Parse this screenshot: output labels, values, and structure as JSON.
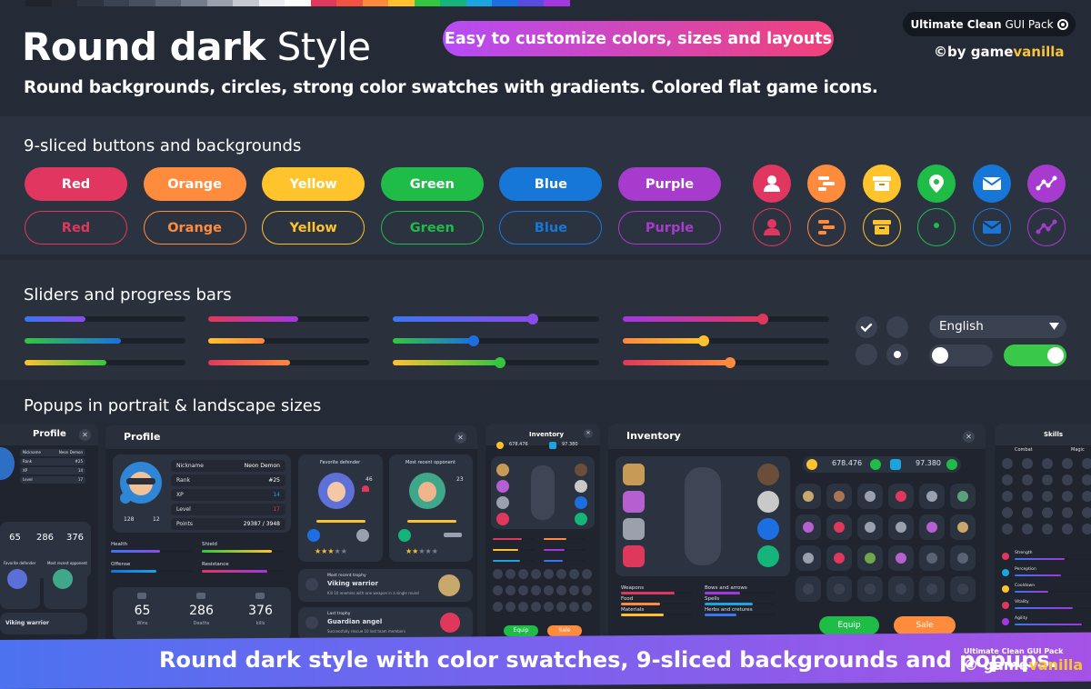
{
  "header": {
    "title_bold": "Round dark",
    "title_light": "Style",
    "subtitle": "Round backgrounds, circles, strong color swatches with gradients. Colored flat game icons.",
    "pill": "Easy to customize colors, sizes and layouts",
    "pack_bold": "Ultimate Clean",
    "pack_rest": "GUI Pack",
    "byline_pre": "©by game",
    "byline_accent": "vanilla"
  },
  "swatches": [
    "#1f232b",
    "#262b35",
    "#2e3440",
    "#3a4150",
    "#47505f",
    "#5a6373",
    "#747d8c",
    "#9aa1ad",
    "#c4c9d1",
    "#eceef1",
    "#ffffff",
    "#e0385c",
    "#f25240",
    "#ff8a3d",
    "#ffc12e",
    "#33c63f",
    "#15b47b",
    "#1aa4e0",
    "#1b6fe0",
    "#5a4be0",
    "#a238e0"
  ],
  "sections": {
    "buttons_title": "9-sliced buttons and backgrounds",
    "sliders_title": "Sliders and progress bars",
    "popups_title": "Popups in portrait & landscape sizes"
  },
  "buttons": [
    {
      "label": "Red",
      "color": "#e03660"
    },
    {
      "label": "Orange",
      "color": "#ff8c3c"
    },
    {
      "label": "Yellow",
      "color": "#ffc32b"
    },
    {
      "label": "Green",
      "color": "#1fbc48"
    },
    {
      "label": "Blue",
      "color": "#1677d9"
    },
    {
      "label": "Purple",
      "color": "#a73bce"
    }
  ],
  "icon_buttons": [
    {
      "icon": "user-icon",
      "color": "#e03660"
    },
    {
      "icon": "gantt-icon",
      "color": "#ff8c3c"
    },
    {
      "icon": "box-icon",
      "color": "#ffc32b"
    },
    {
      "icon": "location-pin-icon",
      "color": "#1fbc48"
    },
    {
      "icon": "mail-icon",
      "color": "#1677d9"
    },
    {
      "icon": "chart-line-icon",
      "color": "#a73bce"
    }
  ],
  "sliders": [
    [
      {
        "v": 0.38,
        "g": [
          "#3a76f0",
          "#8a4be8"
        ]
      },
      {
        "v": 0.56,
        "g": [
          "#e0385c",
          "#a238e0"
        ]
      },
      {
        "v": 0.68,
        "g": [
          "#3a76f0",
          "#8a4be8"
        ],
        "k": "#8a4be8"
      },
      {
        "v": 0.68,
        "g": [
          "#a238e0",
          "#e0385c"
        ],
        "k": "#e0385c"
      }
    ],
    [
      {
        "v": 0.6,
        "g": [
          "#33c63f",
          "#1b6fe0"
        ]
      },
      {
        "v": 0.35,
        "g": [
          "#ffc12e",
          "#ff8a3d"
        ]
      },
      {
        "v": 0.39,
        "g": [
          "#33c63f",
          "#1b6fe0"
        ],
        "k": "#1b6fe0"
      },
      {
        "v": 0.39,
        "g": [
          "#ff8a3d",
          "#ffc12e"
        ],
        "k": "#ffc12e"
      }
    ],
    [
      {
        "v": 0.51,
        "g": [
          "#ffc12e",
          "#33c63f"
        ]
      },
      {
        "v": 0.51,
        "g": [
          "#e0385c",
          "#ff8a3d"
        ]
      },
      {
        "v": 0.52,
        "g": [
          "#ffc12e",
          "#33c63f"
        ],
        "k": "#33c63f"
      },
      {
        "v": 0.52,
        "g": [
          "#e0385c",
          "#ff8a3d"
        ],
        "k": "#ff8a3d"
      }
    ]
  ],
  "controls": {
    "dropdown_value": "English",
    "checkbox_checked": true,
    "radio_selected": "second",
    "toggle_off": false,
    "toggle_on": true,
    "toggle_on_color": "#3ac84a"
  },
  "popups": {
    "profile_small_title": "Profile",
    "profile_title": "Profile",
    "inventory_small_title": "Inventory",
    "inventory_title": "Inventory",
    "skills_title": "Skills",
    "profile": {
      "rows": [
        {
          "label": "Nickname",
          "value": "Neon Demon"
        },
        {
          "label": "Rank",
          "value": "#25"
        },
        {
          "label": "XP",
          "value": "14"
        },
        {
          "label": "Level",
          "value": "17"
        },
        {
          "label": "Points",
          "value": "29387 / 3948"
        }
      ],
      "avatar_stats": [
        "128",
        "12"
      ],
      "bars": [
        {
          "label": "Health"
        },
        {
          "label": "Shield"
        },
        {
          "label": "Offense"
        },
        {
          "label": "Resistance"
        }
      ],
      "stats": [
        {
          "value": "65",
          "label": "Wins"
        },
        {
          "value": "286",
          "label": "Deaths"
        },
        {
          "value": "376",
          "label": "kills"
        }
      ],
      "favorite_title": "Favorite defender",
      "opponent_title": "Most recent opponent",
      "favorite_num": "46",
      "opponent_num": "23",
      "trophy1_small": "Most recent trophy",
      "trophy1_title": "Viking warrior",
      "trophy1_desc": "Kill 10 enemies with one weapon in a single round",
      "trophy2_small": "Last trophy",
      "trophy2_title": "Guardian angel",
      "trophy2_desc": "Successfully rescue 10 lost team members"
    },
    "small_profile": {
      "rows": [
        {
          "label": "Nickname",
          "value": "Neon Demon"
        },
        {
          "label": "Rank",
          "value": "#25"
        },
        {
          "label": "XP",
          "value": "14"
        },
        {
          "label": "Level",
          "value": "17"
        }
      ],
      "stats": [
        {
          "value": "65",
          "label": "Wins"
        },
        {
          "value": "286",
          "label": "Deaths"
        },
        {
          "value": "376",
          "label": "kills"
        }
      ],
      "fav": "Favorite defender",
      "opp": "Most recent opponent",
      "trophy": "Viking warrior"
    },
    "inventory": {
      "coins": "678.476",
      "gems": "97.380",
      "bars": [
        {
          "label": "Weapons"
        },
        {
          "label": "Food"
        },
        {
          "label": "Materials"
        },
        {
          "label": "Bows and arrows"
        },
        {
          "label": "Spells"
        },
        {
          "label": "Herbs and cretures"
        }
      ],
      "equip": "Equip",
      "sale": "Sale"
    },
    "small_inventory": {
      "coins": "678.476",
      "gems": "97.380",
      "equip": "Equip",
      "sale": "Sale"
    },
    "skills": {
      "tabs": [
        "Combat",
        "Magic"
      ],
      "bars": [
        "Strength",
        "Perception",
        "Cooldown",
        "Vitality",
        "Agility"
      ]
    }
  },
  "banner": {
    "text": "Round dark style with color swatches, 9-sliced backgrounds and popups.",
    "pack": "Ultimate Clean GUI Pack",
    "brand_pre": "© game",
    "brand_accent": "vanilla"
  }
}
